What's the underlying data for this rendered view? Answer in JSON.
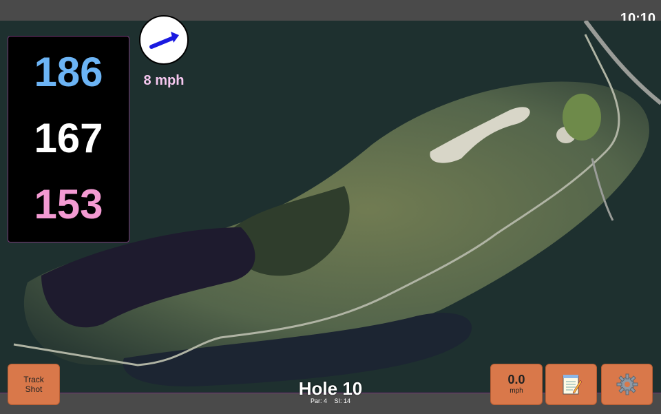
{
  "status_bar": {
    "time": "10:10"
  },
  "distances": {
    "back": "186",
    "center": "167",
    "front": "153"
  },
  "wind": {
    "speed": "8 mph",
    "direction_icon": "arrow-icon"
  },
  "hole": {
    "title": "Hole 10",
    "par": "Par: 4",
    "stroke_index": "SI: 14"
  },
  "buttons": {
    "track_line1": "Track",
    "track_line2": "Shot",
    "speed_value": "0.0",
    "speed_unit": "mph",
    "notes_icon": "notepad-icon",
    "settings_icon": "gear-icon"
  },
  "colors": {
    "back_distance": "#6cb4f5",
    "center_distance": "#ffffff",
    "front_distance": "#f39ad2",
    "button": "#d9784a",
    "wind_arrow": "#1a1ae0"
  }
}
